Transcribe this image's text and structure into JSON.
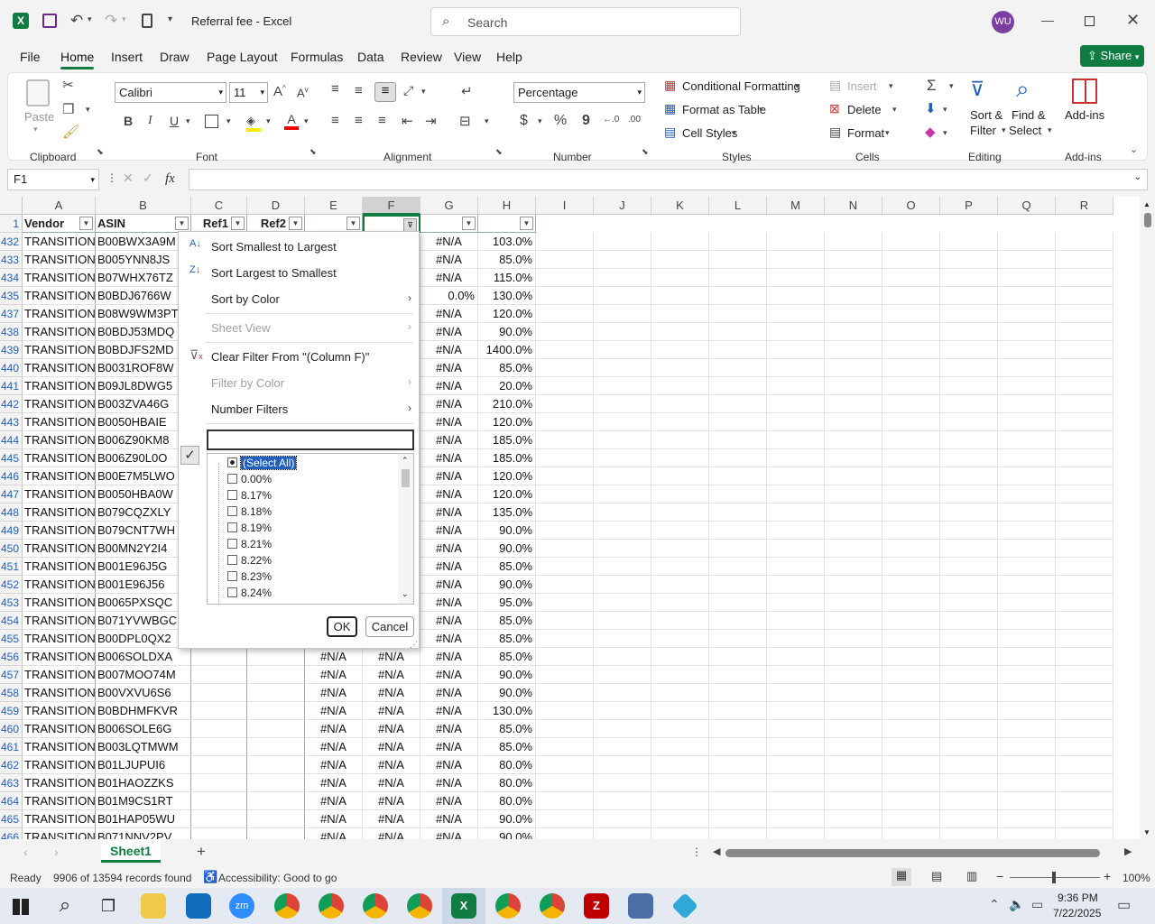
{
  "app": {
    "file_name": "Referral fee",
    "sep": "-",
    "app_name": "Excel",
    "user_initials": "WU"
  },
  "search": {
    "placeholder": "Search"
  },
  "menu_tabs": [
    "File",
    "Home",
    "Insert",
    "Draw",
    "Page Layout",
    "Formulas",
    "Data",
    "Review",
    "View",
    "Help"
  ],
  "share_label": "Share",
  "ribbon": {
    "paste": "Paste",
    "font_name": "Calibri",
    "font_size": "11",
    "number_format": "Percentage",
    "conditional_formatting": "Conditional Formatting",
    "format_as_table": "Format as Table",
    "cell_styles": "Cell Styles",
    "insert": "Insert",
    "delete": "Delete",
    "format": "Format",
    "sort_filter_1": "Sort &",
    "sort_filter_2": "Filter",
    "find_select_1": "Find &",
    "find_select_2": "Select",
    "addins": "Add-ins",
    "groups": {
      "clipboard": "Clipboard",
      "font": "Font",
      "alignment": "Alignment",
      "number": "Number",
      "styles": "Styles",
      "cells": "Cells",
      "editing": "Editing",
      "addins": "Add-ins"
    }
  },
  "namebox": "F1",
  "fx": "fx",
  "columns": [
    "A",
    "B",
    "C",
    "D",
    "E",
    "F",
    "G",
    "H",
    "I",
    "J",
    "K",
    "L",
    "M",
    "N",
    "O",
    "P",
    "Q",
    "R"
  ],
  "headers": {
    "A": "Vendor",
    "B": "ASIN",
    "C": "Ref1",
    "D": "Ref2"
  },
  "rows": [
    {
      "n": "432",
      "a": "TRANSITION",
      "b": "B00BWX3A9M",
      "e": "",
      "f": "",
      "g": "#N/A",
      "h": "103.0%"
    },
    {
      "n": "433",
      "a": "TRANSITION",
      "b": "B005YNN8JS",
      "e": "",
      "f": "",
      "g": "#N/A",
      "h": "85.0%"
    },
    {
      "n": "434",
      "a": "TRANSITION",
      "b": "B07WHX76TZ",
      "e": "",
      "f": "",
      "g": "#N/A",
      "h": "115.0%"
    },
    {
      "n": "435",
      "a": "TRANSITION",
      "b": "B0BDJ6766W",
      "e": "",
      "f": "",
      "g": "0.0%",
      "h": "130.0%"
    },
    {
      "n": "437",
      "a": "TRANSITION",
      "b": "B08W9WM3PT",
      "e": "",
      "f": "",
      "g": "#N/A",
      "h": "120.0%"
    },
    {
      "n": "438",
      "a": "TRANSITION",
      "b": "B0BDJ53MDQ",
      "e": "",
      "f": "",
      "g": "#N/A",
      "h": "90.0%"
    },
    {
      "n": "439",
      "a": "TRANSITION",
      "b": "B0BDJFS2MD",
      "e": "",
      "f": "",
      "g": "#N/A",
      "h": "1400.0%"
    },
    {
      "n": "440",
      "a": "TRANSITION",
      "b": "B0031ROF8W",
      "e": "",
      "f": "",
      "g": "#N/A",
      "h": "85.0%"
    },
    {
      "n": "441",
      "a": "TRANSITION",
      "b": "B09JL8DWG5",
      "e": "",
      "f": "",
      "g": "#N/A",
      "h": "20.0%"
    },
    {
      "n": "442",
      "a": "TRANSITION",
      "b": "B003ZVA46G",
      "e": "",
      "f": "",
      "g": "#N/A",
      "h": "210.0%"
    },
    {
      "n": "443",
      "a": "TRANSITION",
      "b": "B0050HBAIE",
      "e": "",
      "f": "",
      "g": "#N/A",
      "h": "120.0%"
    },
    {
      "n": "444",
      "a": "TRANSITION",
      "b": "B006Z90KM8",
      "e": "",
      "f": "",
      "g": "#N/A",
      "h": "185.0%"
    },
    {
      "n": "445",
      "a": "TRANSITION",
      "b": "B006Z90L0O",
      "e": "",
      "f": "",
      "g": "#N/A",
      "h": "185.0%"
    },
    {
      "n": "446",
      "a": "TRANSITION",
      "b": "B00E7M5LWO",
      "e": "",
      "f": "",
      "g": "#N/A",
      "h": "120.0%"
    },
    {
      "n": "447",
      "a": "TRANSITION",
      "b": "B0050HBA0W",
      "e": "",
      "f": "",
      "g": "#N/A",
      "h": "120.0%"
    },
    {
      "n": "448",
      "a": "TRANSITION",
      "b": "B079CQZXLY",
      "e": "",
      "f": "",
      "g": "#N/A",
      "h": "135.0%"
    },
    {
      "n": "449",
      "a": "TRANSITION",
      "b": "B079CNT7WH",
      "e": "",
      "f": "",
      "g": "#N/A",
      "h": "90.0%"
    },
    {
      "n": "450",
      "a": "TRANSITION",
      "b": "B00MN2Y2I4",
      "e": "",
      "f": "",
      "g": "#N/A",
      "h": "90.0%"
    },
    {
      "n": "451",
      "a": "TRANSITION",
      "b": "B001E96J5G",
      "e": "",
      "f": "",
      "g": "#N/A",
      "h": "85.0%"
    },
    {
      "n": "452",
      "a": "TRANSITION",
      "b": "B001E96J56",
      "e": "",
      "f": "",
      "g": "#N/A",
      "h": "90.0%"
    },
    {
      "n": "453",
      "a": "TRANSITION",
      "b": "B0065PXSQC",
      "e": "",
      "f": "",
      "g": "#N/A",
      "h": "95.0%"
    },
    {
      "n": "454",
      "a": "TRANSITION",
      "b": "B071YVWBGC",
      "e": "",
      "f": "",
      "g": "#N/A",
      "h": "85.0%"
    },
    {
      "n": "455",
      "a": "TRANSITION",
      "b": "B00DPL0QX2",
      "e": "",
      "f": "",
      "g": "#N/A",
      "h": "85.0%"
    },
    {
      "n": "456",
      "a": "TRANSITION",
      "b": "B006SOLDXA",
      "e": "#N/A",
      "f": "#N/A",
      "g": "#N/A",
      "h": "85.0%"
    },
    {
      "n": "457",
      "a": "TRANSITION",
      "b": "B007MOO74M",
      "e": "#N/A",
      "f": "#N/A",
      "g": "#N/A",
      "h": "90.0%"
    },
    {
      "n": "458",
      "a": "TRANSITION",
      "b": "B00VXVU6S6",
      "e": "#N/A",
      "f": "#N/A",
      "g": "#N/A",
      "h": "90.0%"
    },
    {
      "n": "459",
      "a": "TRANSITION",
      "b": "B0BDHMFKVR",
      "e": "#N/A",
      "f": "#N/A",
      "g": "#N/A",
      "h": "130.0%"
    },
    {
      "n": "460",
      "a": "TRANSITION",
      "b": "B006SOLE6G",
      "e": "#N/A",
      "f": "#N/A",
      "g": "#N/A",
      "h": "85.0%"
    },
    {
      "n": "461",
      "a": "TRANSITION",
      "b": "B003LQTMWM",
      "e": "#N/A",
      "f": "#N/A",
      "g": "#N/A",
      "h": "85.0%"
    },
    {
      "n": "462",
      "a": "TRANSITION",
      "b": "B01LJUPUI6",
      "e": "#N/A",
      "f": "#N/A",
      "g": "#N/A",
      "h": "80.0%"
    },
    {
      "n": "463",
      "a": "TRANSITION",
      "b": "B01HAOZZKS",
      "e": "#N/A",
      "f": "#N/A",
      "g": "#N/A",
      "h": "80.0%"
    },
    {
      "n": "464",
      "a": "TRANSITION",
      "b": "B01M9CS1RT",
      "e": "#N/A",
      "f": "#N/A",
      "g": "#N/A",
      "h": "80.0%"
    },
    {
      "n": "465",
      "a": "TRANSITION",
      "b": "B01HAP05WU",
      "e": "#N/A",
      "f": "#N/A",
      "g": "#N/A",
      "h": "90.0%"
    },
    {
      "n": "466",
      "a": "TRANSITION",
      "b": "B071NNV2PV",
      "e": "#N/A",
      "f": "#N/A",
      "g": "#N/A",
      "h": "90.0%"
    }
  ],
  "filter_menu": {
    "sort_asc": "Sort Smallest to Largest",
    "sort_desc": "Sort Largest to Smallest",
    "sort_color": "Sort by Color",
    "sheet_view": "Sheet View",
    "clear_filter": "Clear Filter From \"(Column F)\"",
    "filter_color": "Filter by Color",
    "number_filters": "Number Filters",
    "search_value": "",
    "items": [
      "(Select All)",
      "0.00%",
      "8.17%",
      "8.18%",
      "8.19%",
      "8.21%",
      "8.22%",
      "8.23%",
      "8.24%"
    ],
    "ok": "OK",
    "cancel": "Cancel"
  },
  "sheet_tab": "Sheet1",
  "status": {
    "ready": "Ready",
    "records": "9906 of 13594 records found",
    "accessibility": "Accessibility: Good to go",
    "zoom": "100%"
  },
  "clock": {
    "time": "9:36 PM",
    "date": "7/22/2025"
  },
  "colors": {
    "excel_green": "#107c41",
    "accent_blue": "#1f5fbf"
  }
}
